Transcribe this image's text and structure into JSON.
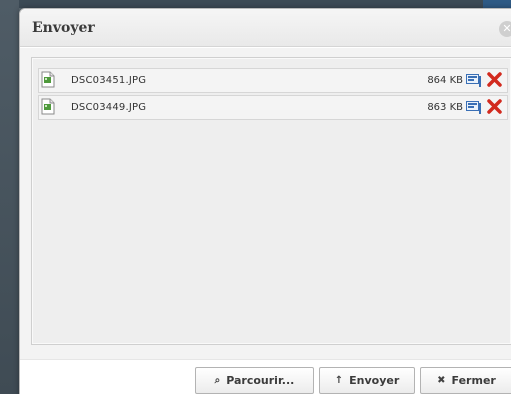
{
  "dialog": {
    "title": "Envoyer"
  },
  "files": [
    {
      "name": "DSC03451.JPG",
      "size": "864 KB",
      "icon": "image-file-icon"
    },
    {
      "name": "DSC03449.JPG",
      "size": "863 KB",
      "icon": "image-file-icon"
    }
  ],
  "buttons": {
    "browse": {
      "label": "Parcourir...",
      "icon": "search-icon",
      "glyph": "⌕"
    },
    "send": {
      "label": "Envoyer",
      "icon": "arrow-up-icon",
      "glyph": "↑"
    },
    "close": {
      "label": "Fermer",
      "icon": "close-icon",
      "glyph": "✖"
    }
  },
  "colors": {
    "remove": "#d22a1e",
    "info": "#3a6fb5",
    "file_icon": "#4f9a3c"
  }
}
